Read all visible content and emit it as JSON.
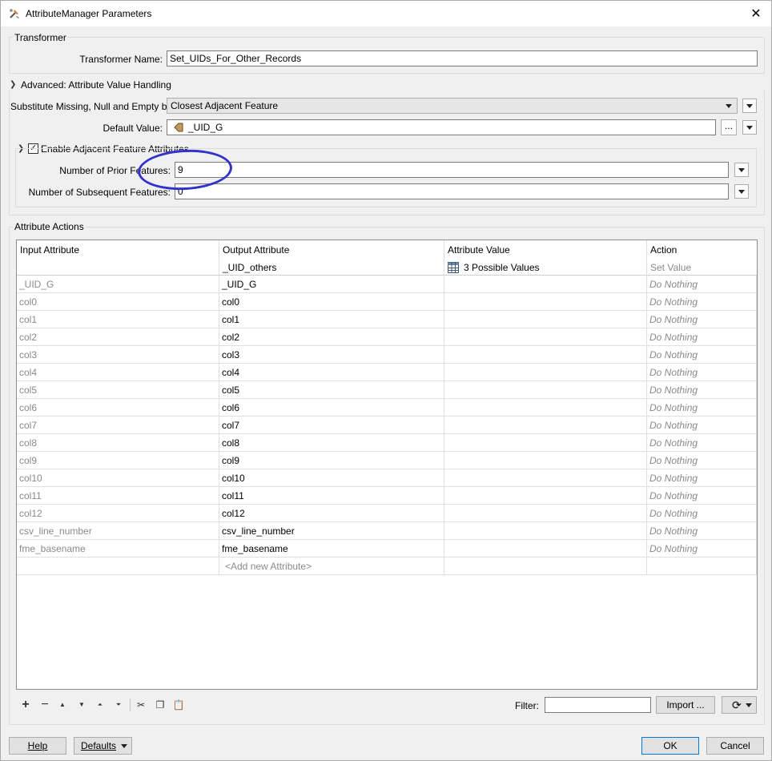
{
  "window": {
    "title": "AttributeManager Parameters"
  },
  "transformer": {
    "group_title": "Transformer",
    "name_label": "Transformer Name:",
    "name_value": "Set_UIDs_For_Other_Records"
  },
  "advanced": {
    "group_title": "Advanced: Attribute Value Handling",
    "substitute_label": "Substitute Missing, Null and Empty by:",
    "substitute_value": "Closest Adjacent Feature",
    "default_label": "Default Value:",
    "default_value": "_UID_G",
    "more_btn": "...",
    "adjacent": {
      "checkbox_label": "Enable Adjacent Feature Attributes",
      "checked": true,
      "prior_label": "Number of Prior Features:",
      "prior_value": "9",
      "subsequent_label": "Number of Subsequent Features:",
      "subsequent_value": "0"
    }
  },
  "actions": {
    "group_title": "Attribute Actions",
    "columns": {
      "input": "Input Attribute",
      "output": "Output Attribute",
      "value": "Attribute Value",
      "action": "Action"
    },
    "sub_header": {
      "output": "_UID_others",
      "value": "3 Possible Values",
      "action": "Set Value"
    },
    "rows": [
      {
        "input": "_UID_G",
        "output": "_UID_G",
        "value": "",
        "action": "Do Nothing"
      },
      {
        "input": "col0",
        "output": "col0",
        "value": "",
        "action": "Do Nothing"
      },
      {
        "input": "col1",
        "output": "col1",
        "value": "",
        "action": "Do Nothing"
      },
      {
        "input": "col2",
        "output": "col2",
        "value": "",
        "action": "Do Nothing"
      },
      {
        "input": "col3",
        "output": "col3",
        "value": "",
        "action": "Do Nothing"
      },
      {
        "input": "col4",
        "output": "col4",
        "value": "",
        "action": "Do Nothing"
      },
      {
        "input": "col5",
        "output": "col5",
        "value": "",
        "action": "Do Nothing"
      },
      {
        "input": "col6",
        "output": "col6",
        "value": "",
        "action": "Do Nothing"
      },
      {
        "input": "col7",
        "output": "col7",
        "value": "",
        "action": "Do Nothing"
      },
      {
        "input": "col8",
        "output": "col8",
        "value": "",
        "action": "Do Nothing"
      },
      {
        "input": "col9",
        "output": "col9",
        "value": "",
        "action": "Do Nothing"
      },
      {
        "input": "col10",
        "output": "col10",
        "value": "",
        "action": "Do Nothing"
      },
      {
        "input": "col11",
        "output": "col11",
        "value": "",
        "action": "Do Nothing"
      },
      {
        "input": "col12",
        "output": "col12",
        "value": "",
        "action": "Do Nothing"
      },
      {
        "input": "csv_line_number",
        "output": "csv_line_number",
        "value": "",
        "action": "Do Nothing"
      },
      {
        "input": "fme_basename",
        "output": "fme_basename",
        "value": "",
        "action": "Do Nothing"
      }
    ],
    "add_new": "<Add new Attribute>"
  },
  "bottom_toolbar": {
    "filter_label": "Filter:",
    "filter_value": "",
    "import_btn": "Import ..."
  },
  "footer": {
    "help": "Help",
    "defaults": "Defaults",
    "ok": "OK",
    "cancel": "Cancel"
  },
  "colors": {
    "annotation": "#3333cc",
    "grey_text": "#8a8a8a"
  }
}
